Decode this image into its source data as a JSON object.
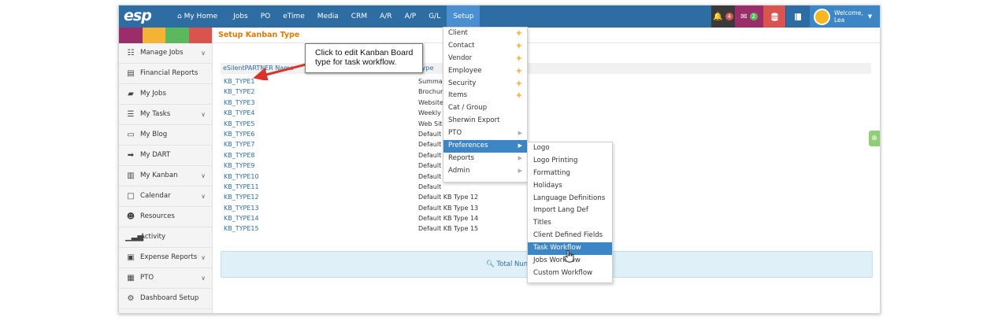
{
  "nav": {
    "logo": "esp",
    "home": "My Home",
    "items": [
      "Jobs",
      "PO",
      "eTime",
      "Media",
      "CRM",
      "A/R",
      "A/P",
      "G/L",
      "Setup"
    ],
    "active": "Setup",
    "notifications_count": "4",
    "messages_count": "2",
    "welcome": "Welcome,",
    "user": "Lea"
  },
  "colors": {
    "nav_bg": "#2e6da4",
    "swatches": [
      "#9b2d6b",
      "#f5b335",
      "#5cb85c",
      "#d9534f"
    ],
    "bell_bg": "#3a3a3a",
    "mail_bg": "#9b2d6b",
    "db_bg": "#d9534f",
    "book_bg": "#2e6da4"
  },
  "sidebar": {
    "items": [
      {
        "label": "Manage Jobs",
        "icon": "sitemap-icon",
        "chevron": true
      },
      {
        "label": "Financial Reports",
        "icon": "report-icon",
        "chevron": false
      },
      {
        "label": "My Jobs",
        "icon": "folder-icon",
        "chevron": false
      },
      {
        "label": "My Tasks",
        "icon": "list-icon",
        "chevron": true
      },
      {
        "label": "My Blog",
        "icon": "comment-icon",
        "chevron": false
      },
      {
        "label": "My DART",
        "icon": "arrow-circle-icon",
        "chevron": false
      },
      {
        "label": "My Kanban",
        "icon": "map-icon",
        "chevron": true
      },
      {
        "label": "Calendar",
        "icon": "calendar-icon",
        "chevron": true
      },
      {
        "label": "Resources",
        "icon": "users-icon",
        "chevron": false
      },
      {
        "label": "Activity",
        "icon": "signal-icon",
        "chevron": false
      },
      {
        "label": "Expense Reports",
        "icon": "money-icon",
        "chevron": true
      },
      {
        "label": "PTO",
        "icon": "calendar-grid-icon",
        "chevron": true
      },
      {
        "label": "Dashboard Setup",
        "icon": "cogs-icon",
        "chevron": false
      }
    ]
  },
  "main": {
    "title": "Setup Kanban Type",
    "col_name": "eSilentPARTNER Name",
    "col_desc": "Type",
    "rows": [
      {
        "name": "KB_TYPE1",
        "desc": "Summary"
      },
      {
        "name": "KB_TYPE2",
        "desc": "Brochure"
      },
      {
        "name": "KB_TYPE3",
        "desc": "Website"
      },
      {
        "name": "KB_TYPE4",
        "desc": "Weekly"
      },
      {
        "name": "KB_TYPE5",
        "desc": "Web Site"
      },
      {
        "name": "KB_TYPE6",
        "desc": "Default"
      },
      {
        "name": "KB_TYPE7",
        "desc": "Default"
      },
      {
        "name": "KB_TYPE8",
        "desc": "Default"
      },
      {
        "name": "KB_TYPE9",
        "desc": "Default"
      },
      {
        "name": "KB_TYPE10",
        "desc": "Default"
      },
      {
        "name": "KB_TYPE11",
        "desc": "Default"
      },
      {
        "name": "KB_TYPE12",
        "desc": "Default KB Type 12"
      },
      {
        "name": "KB_TYPE13",
        "desc": "Default KB Type 13"
      },
      {
        "name": "KB_TYPE14",
        "desc": "Default KB Type 14"
      },
      {
        "name": "KB_TYPE15",
        "desc": "Default KB Type 15"
      }
    ],
    "total": "Total Num"
  },
  "callout": {
    "line1": "Click to edit Kanban Board",
    "line2": "type for task workflow."
  },
  "setup_menu": {
    "items": [
      {
        "label": "Client",
        "marker": "plus"
      },
      {
        "label": "Contact",
        "marker": "plus"
      },
      {
        "label": "Vendor",
        "marker": "plus"
      },
      {
        "label": "Employee",
        "marker": "plus"
      },
      {
        "label": "Security",
        "marker": "plus"
      },
      {
        "label": "Items",
        "marker": "plus"
      },
      {
        "label": "Cat / Group",
        "marker": ""
      },
      {
        "label": "Sherwin Export",
        "marker": ""
      },
      {
        "label": "PTO",
        "marker": "caret"
      },
      {
        "label": "Preferences",
        "marker": "caret"
      },
      {
        "label": "Reports",
        "marker": "caret"
      },
      {
        "label": "Admin",
        "marker": "caret"
      }
    ],
    "selected": "Preferences"
  },
  "preferences_menu": {
    "items": [
      "Logo",
      "Logo Printing",
      "Formatting",
      "Holidays",
      "Language Definitions",
      "Import Lang Def",
      "Titles",
      "Client Defined Fields",
      "Task Workflow",
      "Jobs Workflow",
      "Custom Workflow"
    ],
    "selected": "Task Workflow"
  }
}
